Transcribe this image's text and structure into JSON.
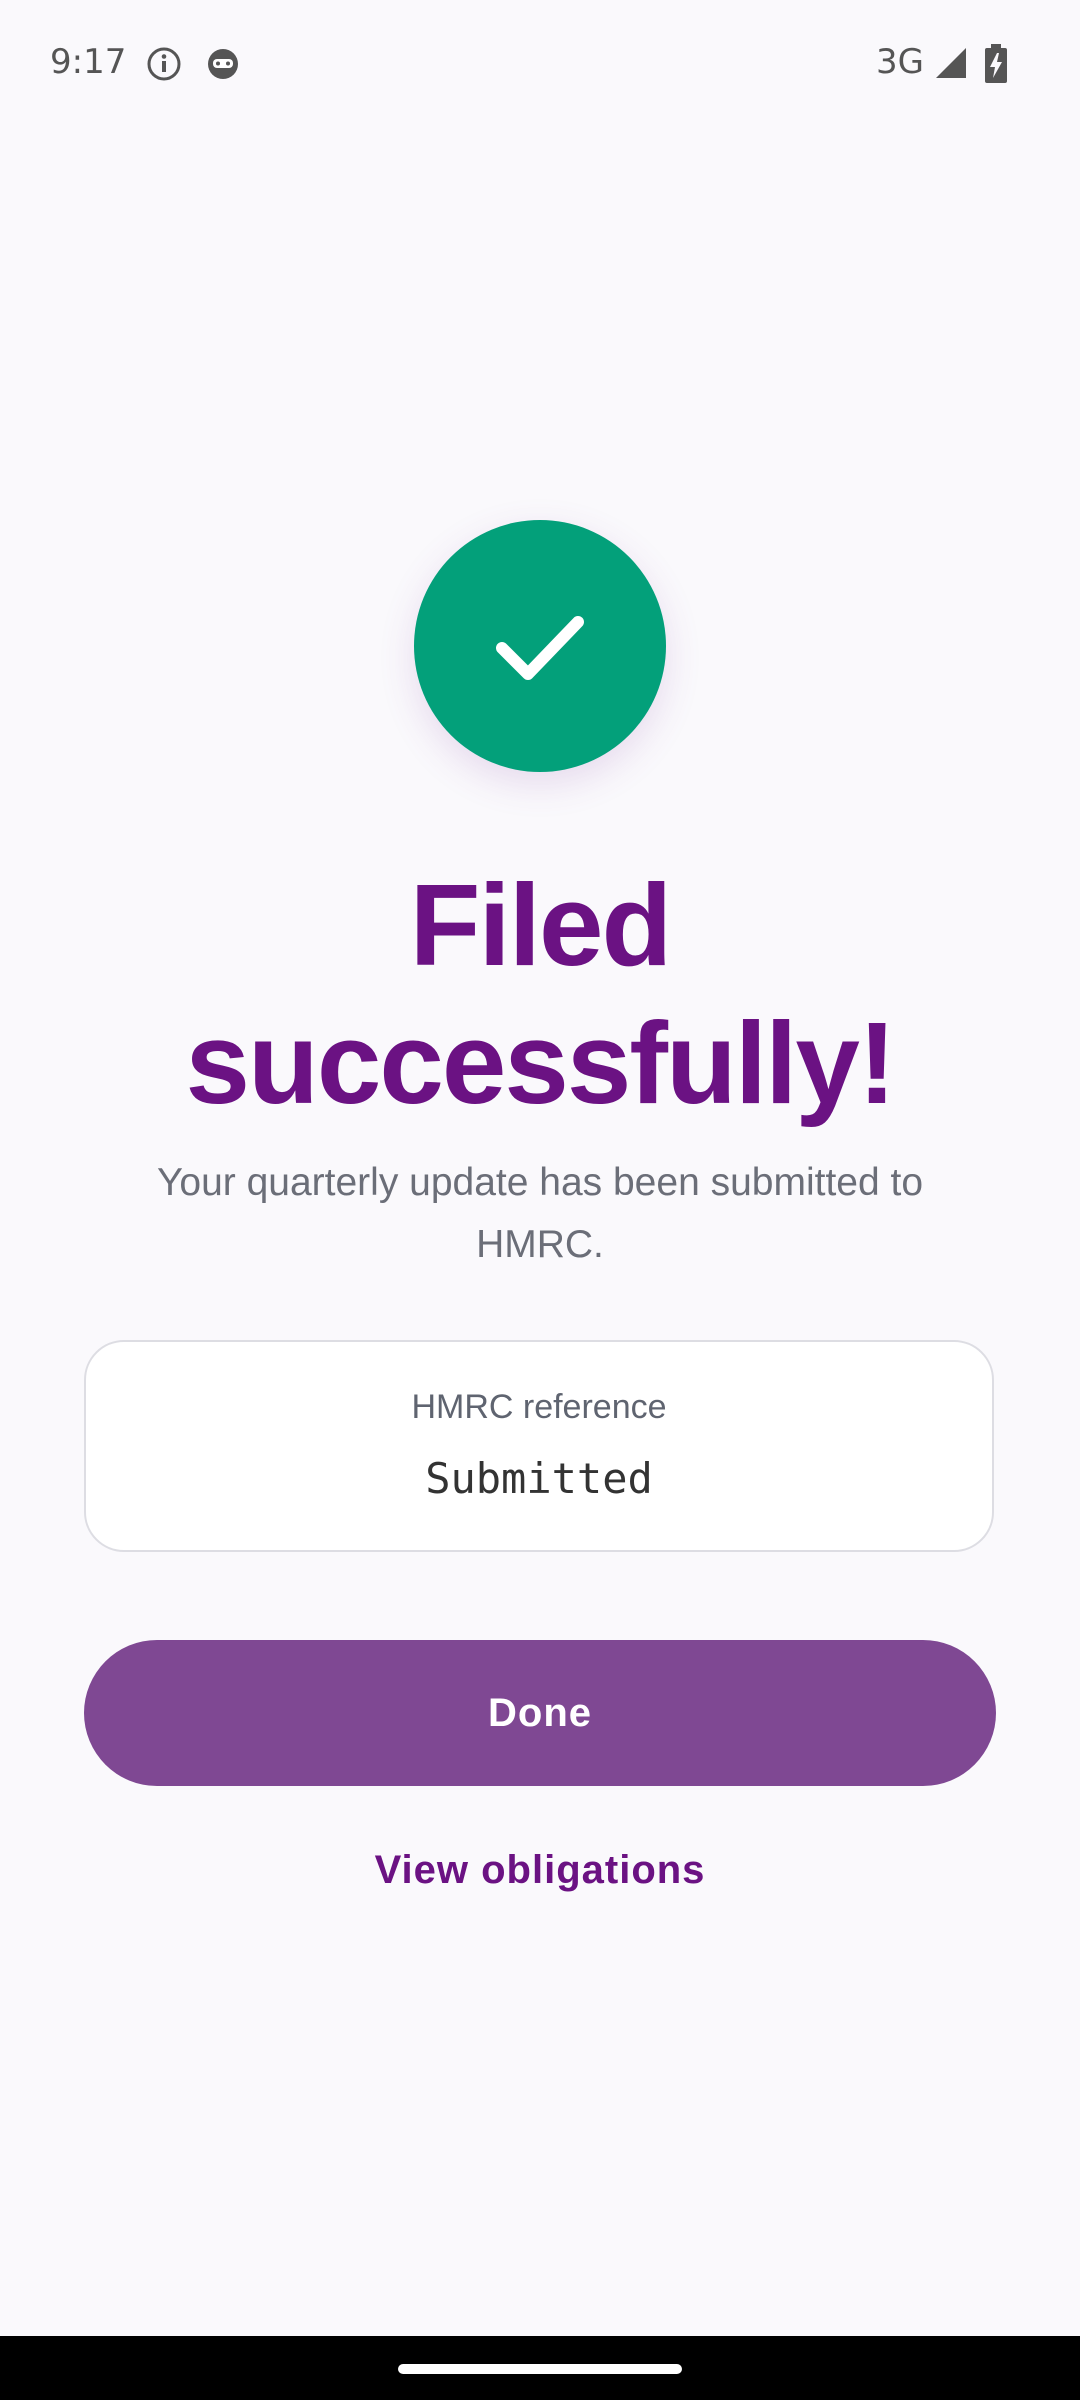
{
  "status_bar": {
    "time": "9:17",
    "network": "3G",
    "icons": [
      "info-icon",
      "face-icon",
      "signal-icon",
      "battery-charging-icon"
    ]
  },
  "success": {
    "icon": "checkmark-icon",
    "color": "#03a07a"
  },
  "headline": "Filed successfully!",
  "subtext": "Your quarterly update has been submitted to HMRC.",
  "reference_card": {
    "label": "HMRC reference",
    "value": "Submitted"
  },
  "actions": {
    "done_label": "Done",
    "view_obligations_label": "View obligations"
  },
  "colors": {
    "brand_purple": "#6b1283",
    "button_purple": "#7f4893",
    "success_green": "#03a07a",
    "background": "#faf9fc"
  }
}
